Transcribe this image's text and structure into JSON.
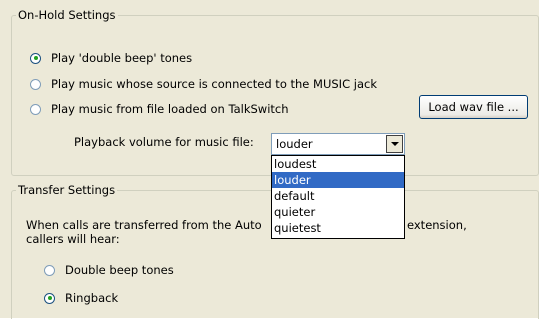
{
  "on_hold": {
    "legend": "On-Hold Settings",
    "options": [
      {
        "label": "Play 'double beep' tones",
        "selected": true
      },
      {
        "label": "Play music whose source is connected to the MUSIC jack",
        "selected": false
      },
      {
        "label": "Play music from file loaded on TalkSwitch",
        "selected": false
      }
    ],
    "load_button": "Load wav file ...",
    "volume_label": "Playback volume for music file:",
    "volume_value": "louder",
    "volume_options": [
      "loudest",
      "louder",
      "default",
      "quieter",
      "quietest"
    ]
  },
  "transfer": {
    "legend": "Transfer Settings",
    "desc_line1_start": "When calls are transferred from the Auto",
    "desc_line1_end": "extension,",
    "desc_line2": "callers will hear:",
    "options": [
      {
        "label": "Double beep tones",
        "selected": false
      },
      {
        "label": "Ringback",
        "selected": true
      }
    ]
  },
  "colors": {
    "selection": "#316ac5",
    "radio_checked": "#21a121",
    "panel": "#ece9d8"
  }
}
